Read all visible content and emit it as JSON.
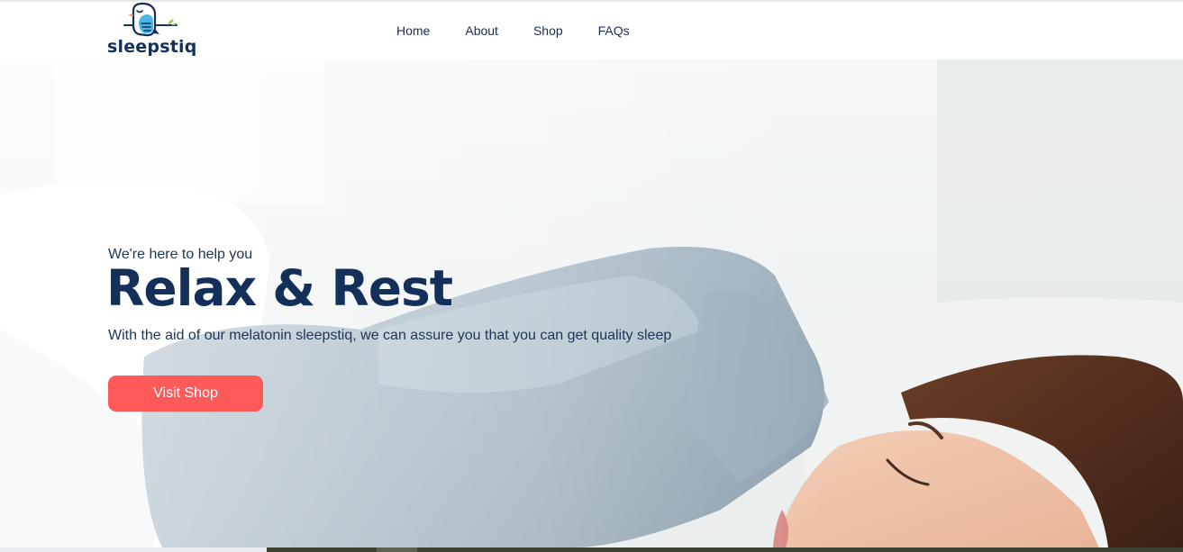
{
  "brand": {
    "name": "sleepstiq",
    "colors": {
      "navy": "#14305a",
      "accent": "#ff5a5a",
      "leaf": "#8bc34a"
    }
  },
  "nav": {
    "items": [
      {
        "label": "Home"
      },
      {
        "label": "About"
      },
      {
        "label": "Shop"
      },
      {
        "label": "FAQs"
      }
    ]
  },
  "hero": {
    "eyebrow": "We're here to help you",
    "headline": "Relax & Rest",
    "subtext": "With the aid of our melatonin sleepstiq, we can assure you that you can get quality sleep",
    "cta_label": "Visit Shop",
    "background_image": "woman-sleeping-in-bed-photo"
  }
}
